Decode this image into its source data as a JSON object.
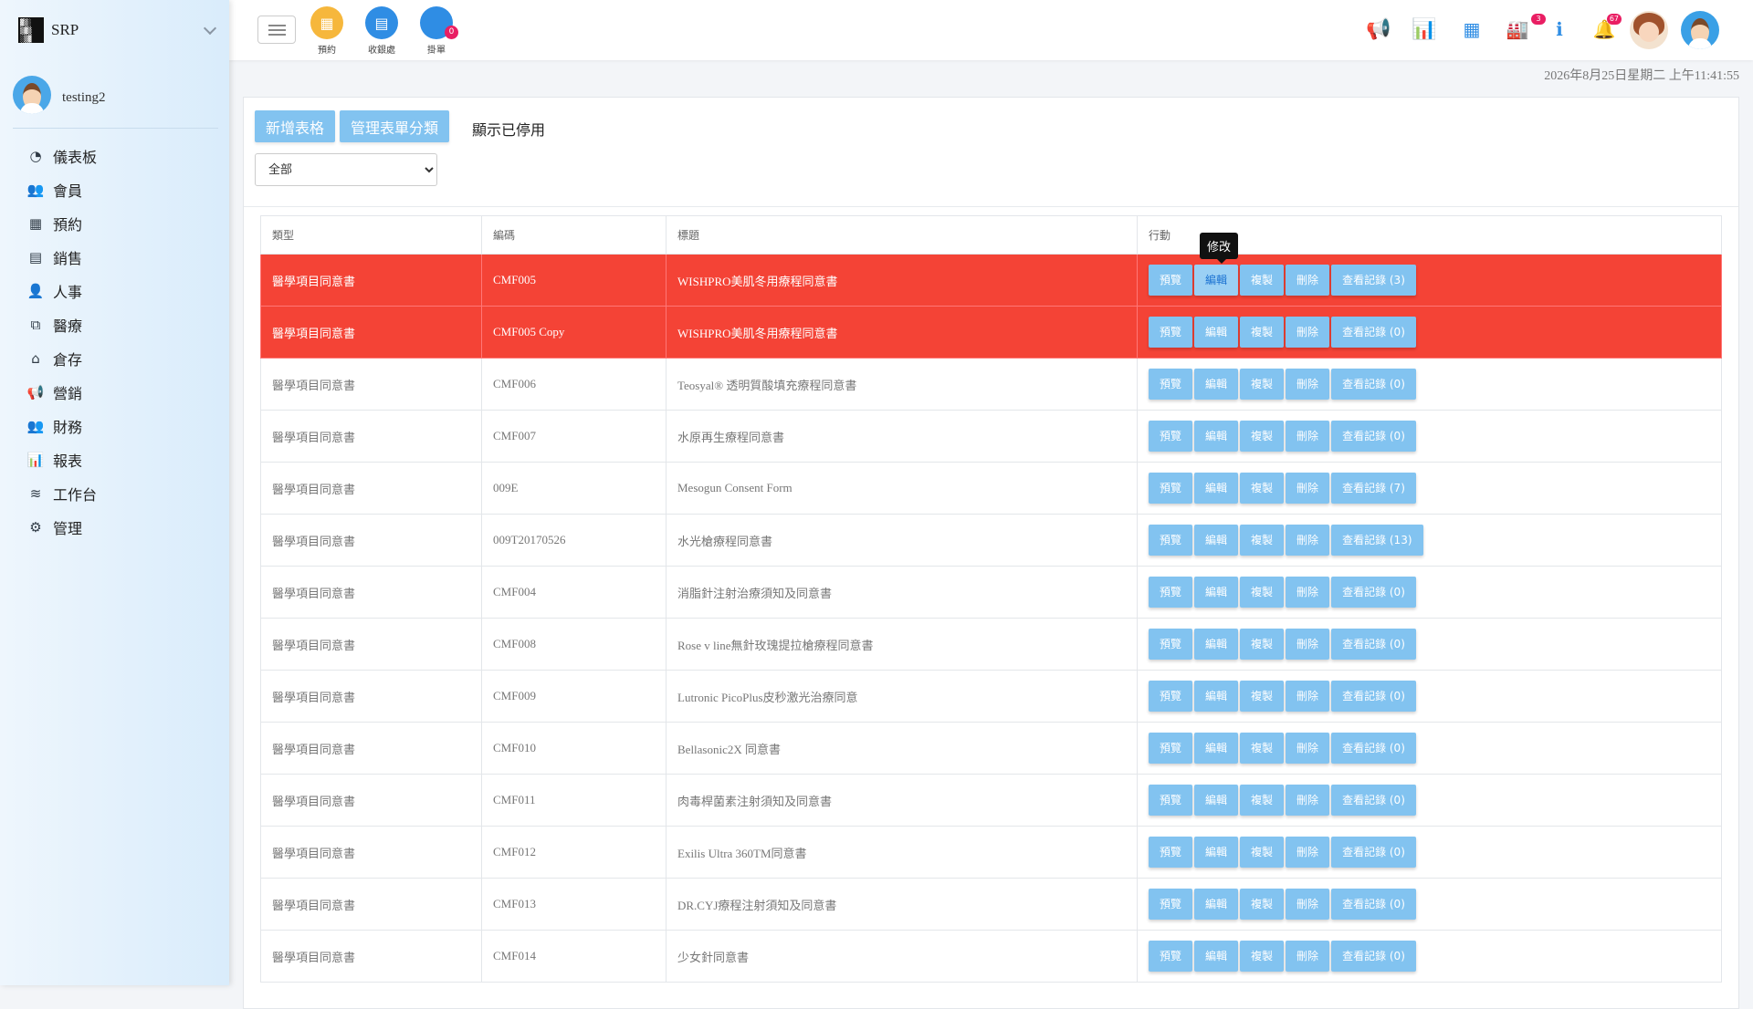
{
  "brand": {
    "name": "SRP",
    "logo_icon": "srp-logo-icon"
  },
  "user": {
    "name": "testing2"
  },
  "sidebar": {
    "items": [
      {
        "label": "儀表板",
        "icon": "pie-chart-icon",
        "glyph": "◔"
      },
      {
        "label": "會員",
        "icon": "users-icon",
        "glyph": "👥"
      },
      {
        "label": "預約",
        "icon": "calendar-icon",
        "glyph": "▦"
      },
      {
        "label": "銷售",
        "icon": "card-icon",
        "glyph": "▤"
      },
      {
        "label": "人事",
        "icon": "person-icon",
        "glyph": "👤"
      },
      {
        "label": "醫療",
        "icon": "medical-icon",
        "glyph": "⧉"
      },
      {
        "label": "倉存",
        "icon": "warehouse-icon",
        "glyph": "⌂"
      },
      {
        "label": "營銷",
        "icon": "megaphone-icon",
        "glyph": "📢"
      },
      {
        "label": "財務",
        "icon": "finance-users-icon",
        "glyph": "👥"
      },
      {
        "label": "報表",
        "icon": "bar-chart-icon",
        "glyph": "📊"
      },
      {
        "label": "工作台",
        "icon": "layers-icon",
        "glyph": "≋"
      },
      {
        "label": "管理",
        "icon": "gear-icon",
        "glyph": "⚙"
      }
    ]
  },
  "topbar": {
    "quick": [
      {
        "label": "預約",
        "icon": "calendar-icon",
        "color": "#f6b73c",
        "glyph": "▦"
      },
      {
        "label": "收銀處",
        "icon": "cashier-icon",
        "color": "#2f8de4",
        "glyph": "▤"
      },
      {
        "label": "掛單",
        "icon": "pending-order-icon",
        "color": "#2f8de4",
        "glyph": "●",
        "badge": "0"
      }
    ],
    "badges": {
      "queue": "3",
      "notifications": "67"
    },
    "icons": {
      "announcement": "📢",
      "report": "📊",
      "qr": "▦",
      "queue": "🏭",
      "info": "ℹ",
      "bell": "🔔"
    }
  },
  "datetime": "2026年8月25日星期二 上午11:41:55",
  "toolbar": {
    "add_form": "新增表格",
    "manage_category": "管理表單分類",
    "show_disabled": "顯示已停用",
    "category_selected": "全部"
  },
  "table": {
    "headers": {
      "type": "類型",
      "code": "編碼",
      "title": "標題",
      "actions": "行動"
    },
    "action_labels": {
      "preview": "預覽",
      "edit": "編輯",
      "copy": "複製",
      "delete": "刪除",
      "records": "查看記錄"
    },
    "tooltip": "修改",
    "rows": [
      {
        "type": "醫學項目同意書",
        "code": "CMF005",
        "title": "WISHPRO美肌冬用療程同意書",
        "records": "查看記錄 (3)",
        "highlight": true
      },
      {
        "type": "醫學項目同意書",
        "code": "CMF005 Copy",
        "title": "WISHPRO美肌冬用療程同意書",
        "records": "查看記錄 (0)",
        "highlight": true
      },
      {
        "type": "醫學項目同意書",
        "code": "CMF006",
        "title": "Teosyal® 透明質酸填充療程同意書",
        "records": "查看記錄 (0)",
        "highlight": false
      },
      {
        "type": "醫學項目同意書",
        "code": "CMF007",
        "title": "水原再生療程同意書",
        "records": "查看記錄 (0)",
        "highlight": false
      },
      {
        "type": "醫學項目同意書",
        "code": "009E",
        "title": "Mesogun Consent Form",
        "records": "查看記錄 (7)",
        "highlight": false
      },
      {
        "type": "醫學項目同意書",
        "code": "009T20170526",
        "title": "水光槍療程同意書",
        "records": "查看記錄 (13)",
        "highlight": false
      },
      {
        "type": "醫學項目同意書",
        "code": "CMF004",
        "title": "消脂針注射治療須知及同意書",
        "records": "查看記錄 (0)",
        "highlight": false
      },
      {
        "type": "醫學項目同意書",
        "code": "CMF008",
        "title": "Rose v line無針玫瑰提拉槍療程同意書",
        "records": "查看記錄 (0)",
        "highlight": false
      },
      {
        "type": "醫學項目同意書",
        "code": "CMF009",
        "title": "Lutronic PicoPlus皮秒激光治療同意",
        "records": "查看記錄 (0)",
        "highlight": false
      },
      {
        "type": "醫學項目同意書",
        "code": "CMF010",
        "title": "Bellasonic2X 同意書",
        "records": "查看記錄 (0)",
        "highlight": false
      },
      {
        "type": "醫學項目同意書",
        "code": "CMF011",
        "title": "肉毒桿菌素注射須知及同意書",
        "records": "查看記錄 (0)",
        "highlight": false
      },
      {
        "type": "醫學項目同意書",
        "code": "CMF012",
        "title": "Exilis Ultra 360TM同意書",
        "records": "查看記錄 (0)",
        "highlight": false
      },
      {
        "type": "醫學項目同意書",
        "code": "CMF013",
        "title": "DR.CYJ療程注射須知及同意書",
        "records": "查看記錄 (0)",
        "highlight": false
      },
      {
        "type": "醫學項目同意書",
        "code": "CMF014",
        "title": "少女針同意書",
        "records": "查看記錄 (0)",
        "highlight": false
      }
    ]
  },
  "colors": {
    "highlight_row": "#f44336",
    "button": "#82c3f0",
    "accent": "#1b72d1"
  }
}
